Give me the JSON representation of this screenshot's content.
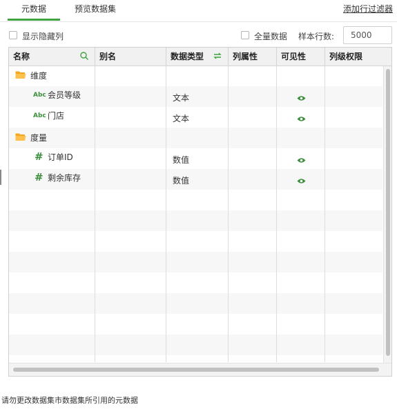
{
  "tabs": [
    {
      "label": "元数据",
      "active": true
    },
    {
      "label": "预览数据集",
      "active": false
    }
  ],
  "add_filter_link": "添加行过滤器",
  "options": {
    "show_hidden_label": "显示隐藏列",
    "show_hidden_checked": false,
    "full_data_label": "全量数据",
    "full_data_checked": false,
    "sample_rows_label": "样本行数:",
    "sample_rows_value": "5000"
  },
  "columns": {
    "name": "名称",
    "alias": "别名",
    "data_type": "数据类型",
    "attribute": "列属性",
    "visibility": "可见性",
    "permission": "列级权限"
  },
  "header_icons": {
    "name": "search-icon",
    "data_type": "refresh-icon"
  },
  "rows": [
    {
      "kind": "group",
      "icon": "folder-icon",
      "name": "维度"
    },
    {
      "kind": "field",
      "icon": "abc-icon",
      "icon_text": "Abc",
      "name": "会员等级",
      "type": "文本",
      "visible": true
    },
    {
      "kind": "field",
      "icon": "abc-icon",
      "icon_text": "Abc",
      "name": "门店",
      "type": "文本",
      "visible": true
    },
    {
      "kind": "group",
      "icon": "folder-icon",
      "name": "度量"
    },
    {
      "kind": "field",
      "icon": "hash-icon",
      "icon_text": "#",
      "name": "订单ID",
      "type": "数值",
      "visible": true
    },
    {
      "kind": "field",
      "icon": "hash-icon",
      "icon_text": "#",
      "name": "剩余库存",
      "type": "数值",
      "visible": true
    }
  ],
  "footer_note": "请勿更改数据集市数据集所引用的元数据",
  "colors": {
    "accent": "#3fa33f",
    "folder": "#f5a623",
    "icon_green": "#3d8f3d"
  }
}
